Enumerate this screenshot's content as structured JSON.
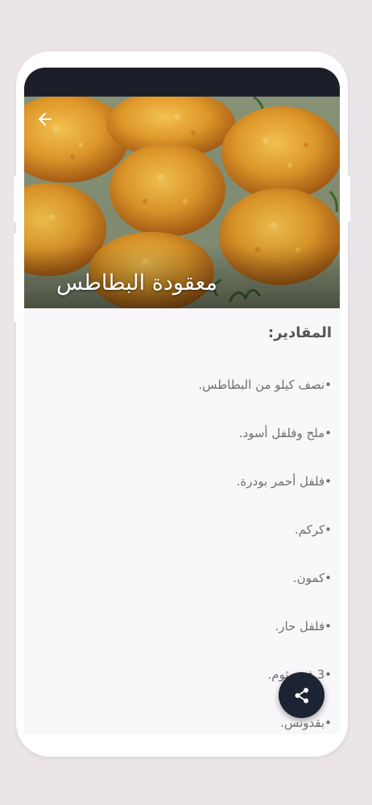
{
  "recipe": {
    "title": "معقودة البطاطس",
    "hero_image": "fried-potato-patties-photo"
  },
  "toolbar": {
    "back_icon": "arrow-left-icon"
  },
  "ingredients": {
    "heading": "المقادير:",
    "items": [
      "•نصف كيلو من البطاطس.",
      "•ملح وفلفل أسود.",
      "•فلفل أحمر بودرة.",
      "•كركم.",
      "•كمون.",
      "•فلفل حار.",
      "•3 فص ثوم.",
      "•بقدونس."
    ]
  },
  "fab": {
    "icon": "share-icon"
  },
  "colors": {
    "status_bar": "#1c1f2a",
    "fab": "#1c2333",
    "background": "#f9f7fa"
  }
}
